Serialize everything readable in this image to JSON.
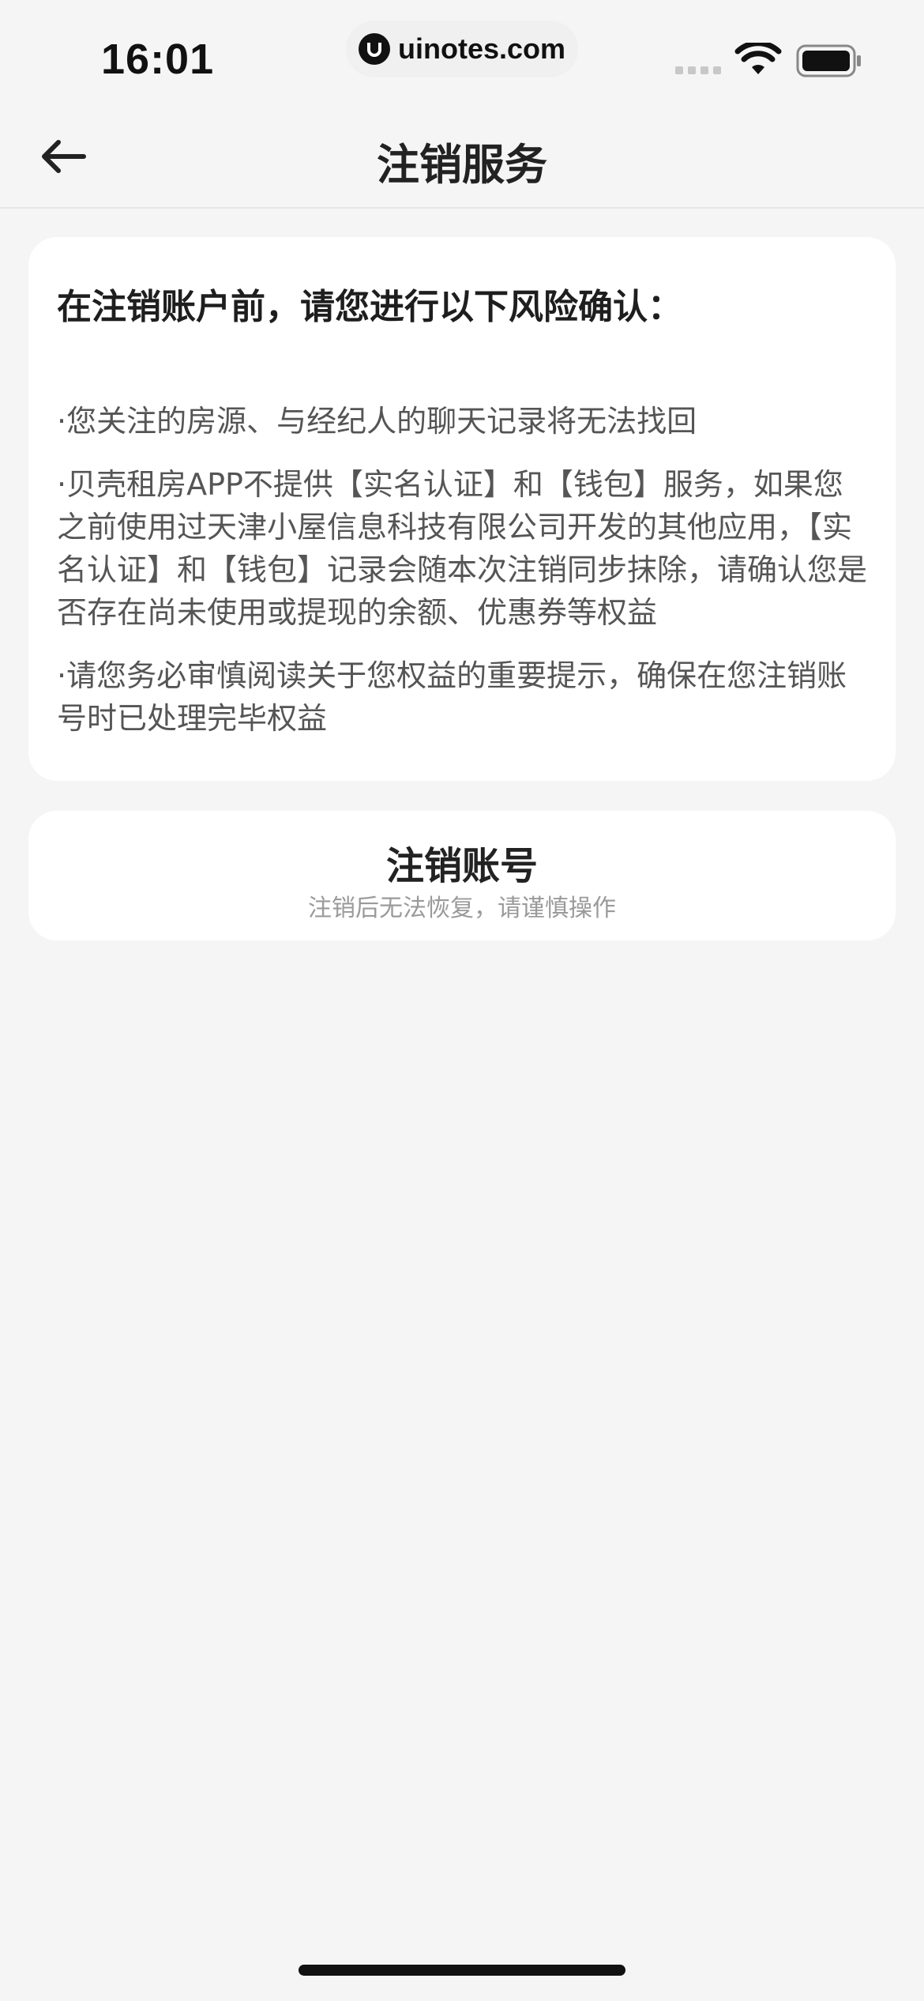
{
  "status_bar": {
    "time": "16:01",
    "url": "uinotes.com"
  },
  "nav": {
    "title": "注销服务",
    "back_icon": "arrow-left-icon"
  },
  "risk_card": {
    "heading": "在注销账户前，请您进行以下风险确认：",
    "items": [
      "·您关注的房源、与经纪人的聊天记录将无法找回",
      "·贝壳租房APP不提供【实名认证】和【钱包】服务，如果您之前使用过天津小屋信息科技有限公司开发的其他应用，【实名认证】和【钱包】记录会随本次注销同步抹除，请确认您是否存在尚未使用或提现的余额、优惠券等权益",
      "·请您务必审慎阅读关于您权益的重要提示，确保在您注销账号时已处理完毕权益"
    ]
  },
  "cancel_account": {
    "title": "注销账号",
    "subtitle": "注销后无法恢复，请谨慎操作"
  },
  "colors": {
    "background": "#f5f5f5",
    "card": "#ffffff",
    "text_primary": "#222222",
    "text_secondary": "#555555",
    "text_muted": "#9a9a9a"
  }
}
